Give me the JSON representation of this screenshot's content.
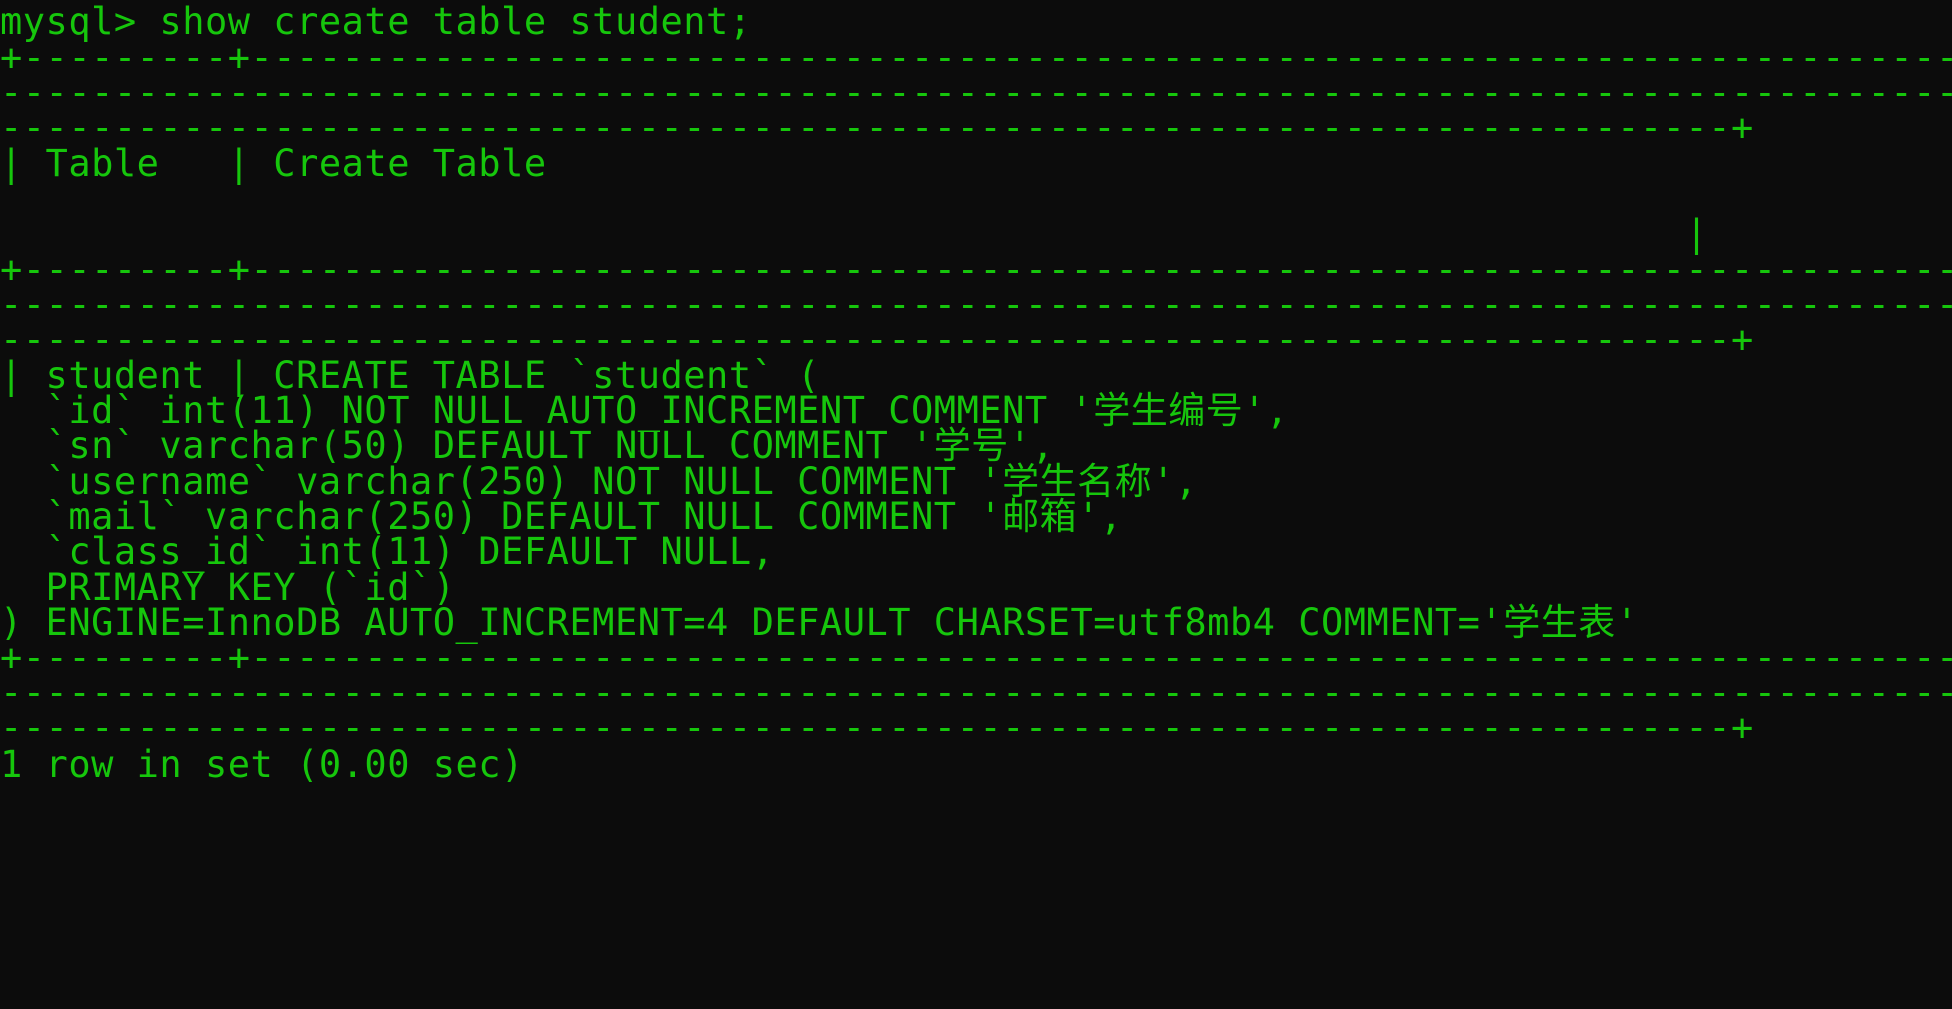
{
  "terminal": {
    "foreground": "#16c60c",
    "background": "#0c0c0c",
    "lines": [
      "mysql> show create table student;",
      "+---------+-------------------------------------------------------------------------------------------------------------------------------",
      "----------------------------------------------------------------------------------------------------------------------------------------------------------------------------",
      "----------------------------------------------------------------------------+",
      "| Table   | Create Table",
      "",
      "                                                                          |",
      "+---------+-------------------------------------------------------------------------------------------------------------------------------",
      "----------------------------------------------------------------------------------------------------------------------------------------------------------------------------",
      "----------------------------------------------------------------------------+",
      "| student | CREATE TABLE `student` (",
      "  `id` int(11) NOT NULL AUTO_INCREMENT COMMENT '学生编号',",
      "  `sn` varchar(50) DEFAULT NULL COMMENT '学号',",
      "  `username` varchar(250) NOT NULL COMMENT '学生名称',",
      "  `mail` varchar(250) DEFAULT NULL COMMENT '邮箱',",
      "  `class_id` int(11) DEFAULT NULL,",
      "  PRIMARY KEY (`id`)",
      ") ENGINE=InnoDB AUTO_INCREMENT=4 DEFAULT CHARSET=utf8mb4 COMMENT='学生表'",
      "+---------+-------------------------------------------------------------------------------------------------------------------------------",
      "----------------------------------------------------------------------------------------------------------------------------------------------------------------------------",
      "----------------------------------------------------------------------------+",
      "1 row in set (0.00 sec)"
    ]
  }
}
